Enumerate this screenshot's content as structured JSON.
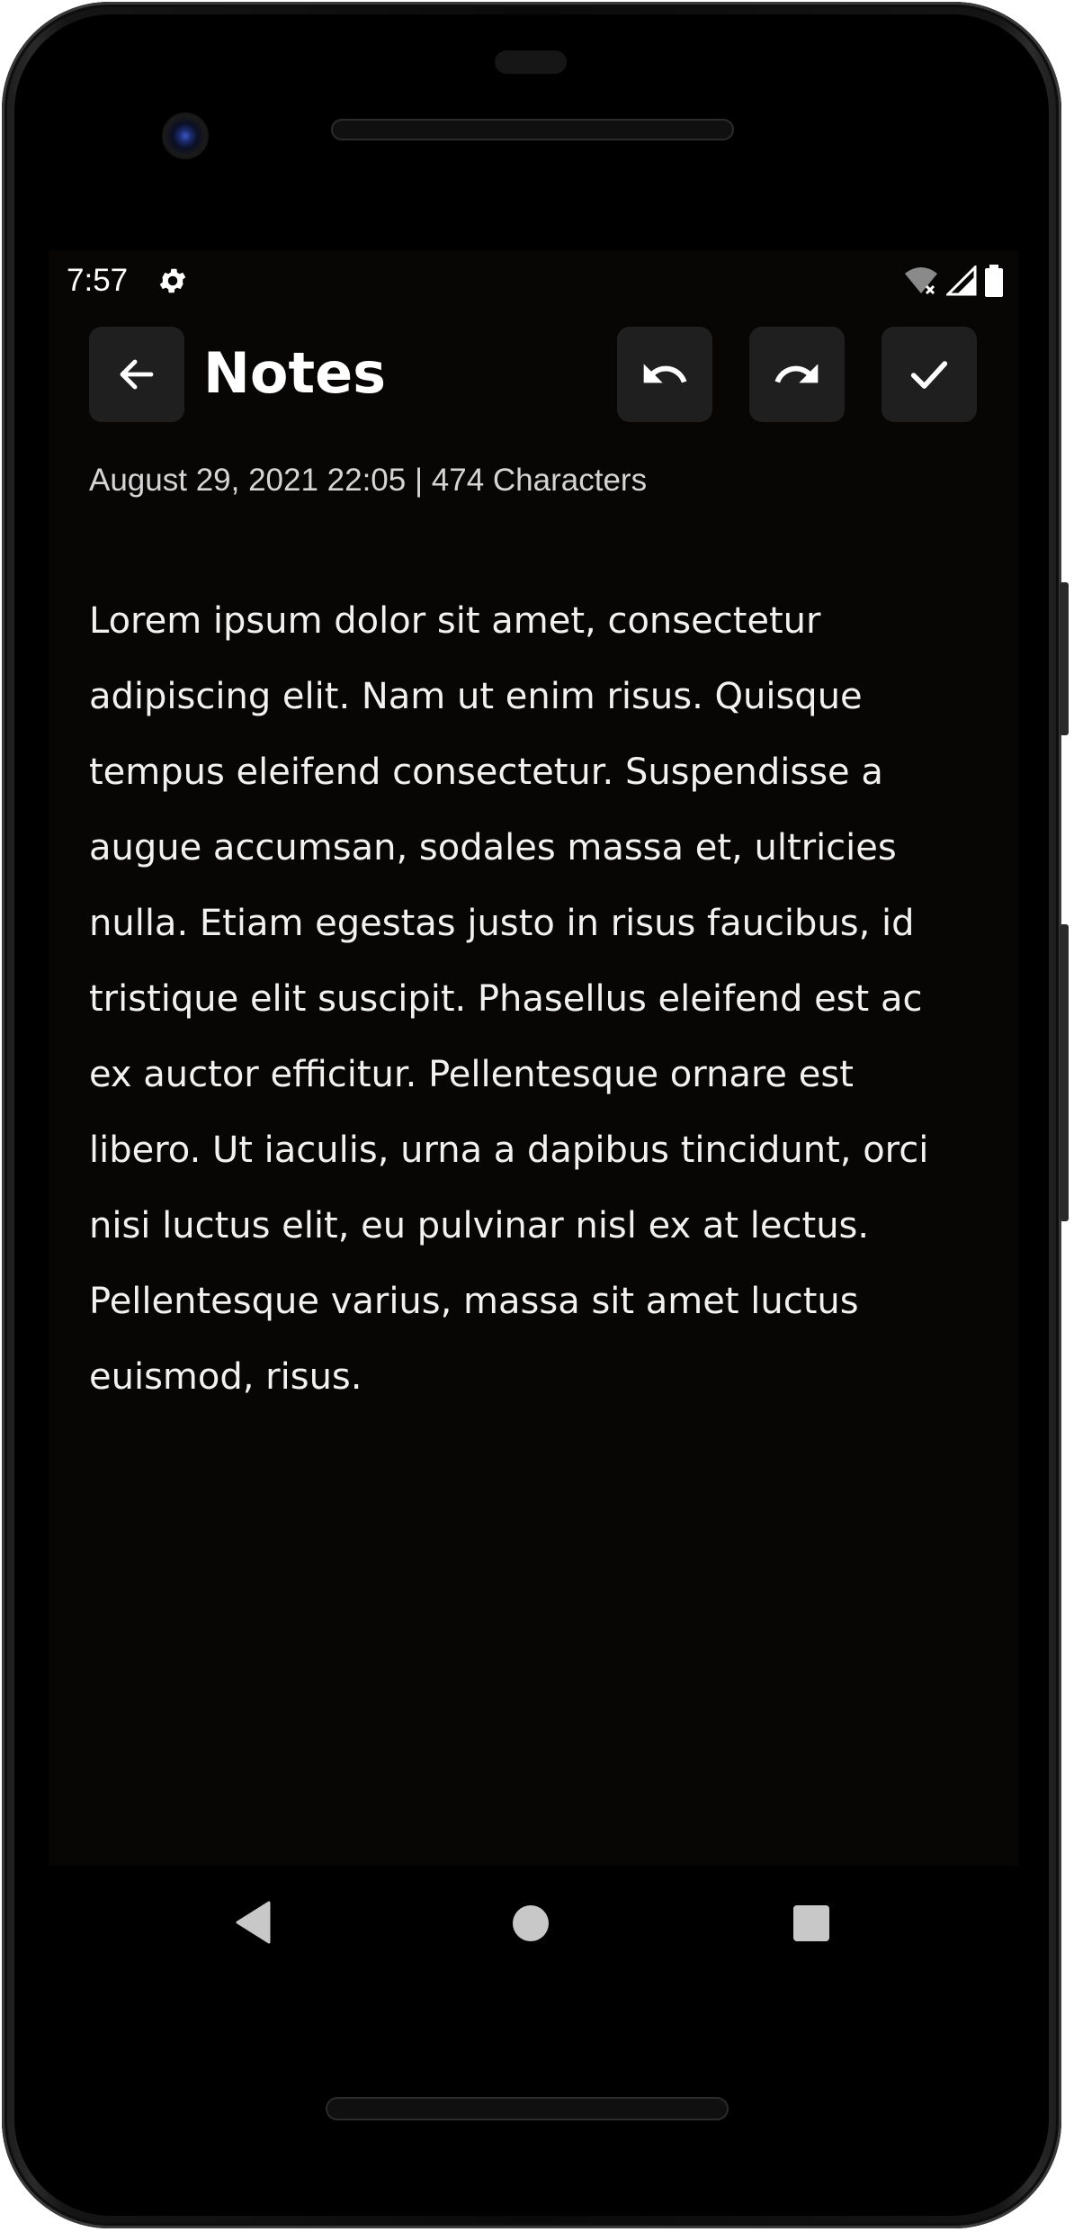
{
  "status_bar": {
    "time": "7:57"
  },
  "toolbar": {
    "title": "Notes"
  },
  "note": {
    "meta": "August 29, 2021 22:05 | 474 Characters",
    "body": "Lorem ipsum dolor sit amet, consectetur adipiscing elit. Nam ut enim risus. Quisque tempus eleifend consectetur. Suspendisse a augue accumsan, sodales massa et, ultricies nulla. Etiam egestas justo in risus faucibus, id tristique elit suscipit. Phasellus eleifend est ac ex auctor efficitur. Pellentesque ornare est libero. Ut iaculis, urna a dapibus tincidunt, orci nisi luctus elit, eu pulvinar nisl ex at lectus. Pellentesque varius, massa sit amet luctus euismod, risus."
  },
  "icons": {
    "status": [
      "gear-icon",
      "wifi-off-icon",
      "signal-icon",
      "battery-icon"
    ],
    "toolbar": [
      "arrow-left-icon",
      "undo-icon",
      "redo-icon",
      "check-icon"
    ],
    "nav": [
      "nav-back-icon",
      "nav-home-icon",
      "nav-recents-icon"
    ]
  },
  "colors": {
    "background": "#070605",
    "button": "#1f1f1f",
    "text": "#f1f1f1"
  }
}
